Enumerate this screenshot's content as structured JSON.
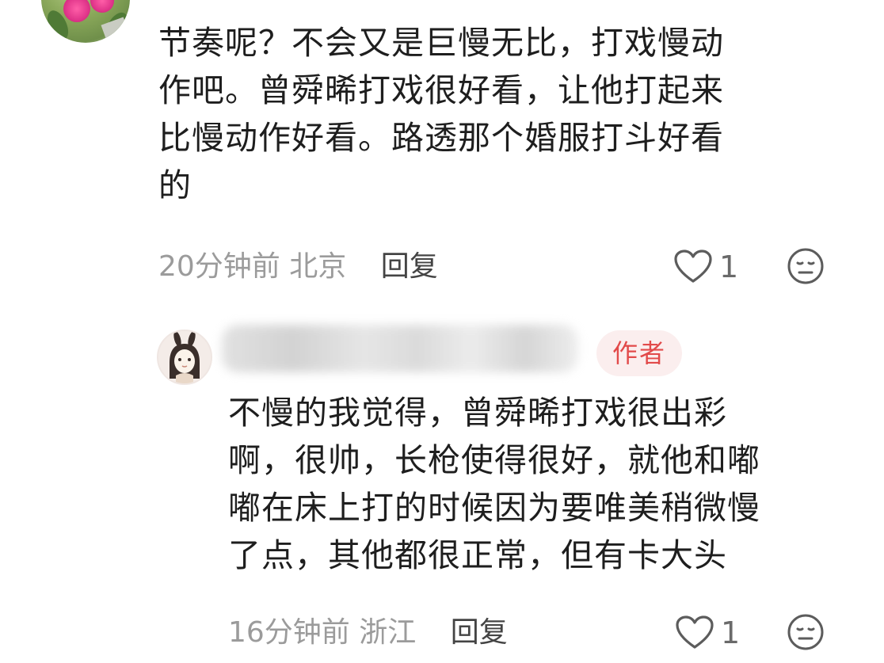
{
  "main_comment": {
    "text_lines": [
      "节奏呢？不会又是巨慢无比，打戏慢动",
      "作吧。曾舜晞打戏很好看，让他打起来",
      "比慢动作好看。路透那个婚服打斗好看",
      "的"
    ],
    "time": "20分钟前",
    "location": "北京",
    "reply_label": "回复",
    "like_count": "1"
  },
  "reply_comment": {
    "author_badge": "作者",
    "text_lines": [
      "不慢的我觉得，曾舜晞打戏很出彩",
      "啊，很帅，长枪使得很好，就他和嘟",
      "嘟在床上打的时候因为要唯美稍微慢",
      "了点，其他都很正常，但有卡大头"
    ],
    "time": "16分钟前",
    "location": "浙江",
    "reply_label": "回复",
    "like_count": "1"
  },
  "colors": {
    "text": "#1e1e1e",
    "meta": "#9b9b9b",
    "badge_text": "#e24a4a",
    "badge_bg": "#fbeeee"
  },
  "icons": [
    "heart-icon",
    "neutral-face-icon"
  ]
}
